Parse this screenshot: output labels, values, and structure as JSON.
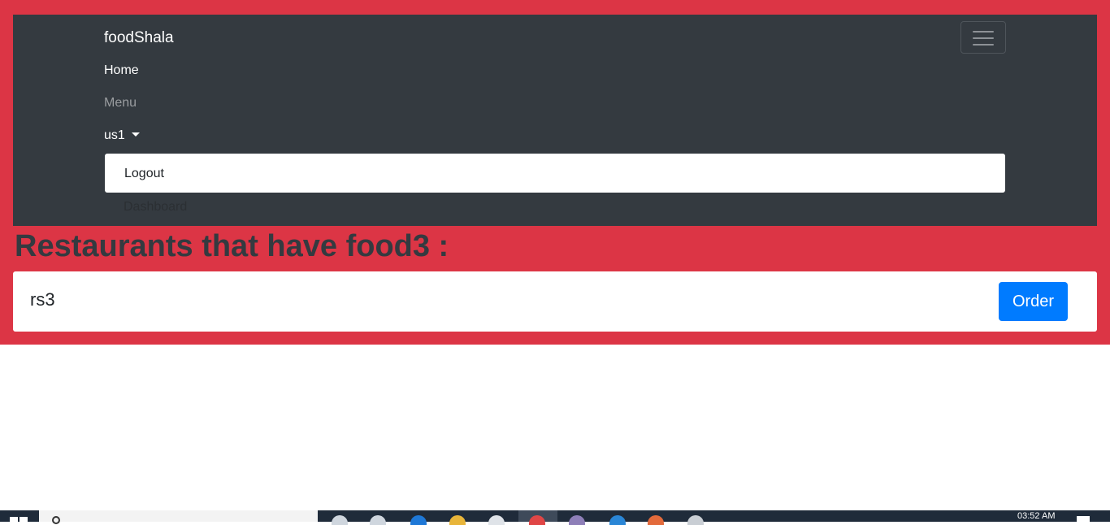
{
  "navbar": {
    "brand": "foodShala",
    "links": {
      "home": "Home",
      "menu": "Menu",
      "user": "us1"
    },
    "dropdown": {
      "logout": "Logout",
      "dashboard": "Dashboard"
    }
  },
  "main": {
    "heading": "Restaurants that have food3 :",
    "results": [
      {
        "name": "rs3",
        "action": "Order"
      }
    ]
  },
  "taskbar": {
    "clock": "03:52 AM"
  },
  "colors": {
    "background_accent": "#dc3545",
    "navbar": "#343a40",
    "primary_button": "#007bff"
  }
}
